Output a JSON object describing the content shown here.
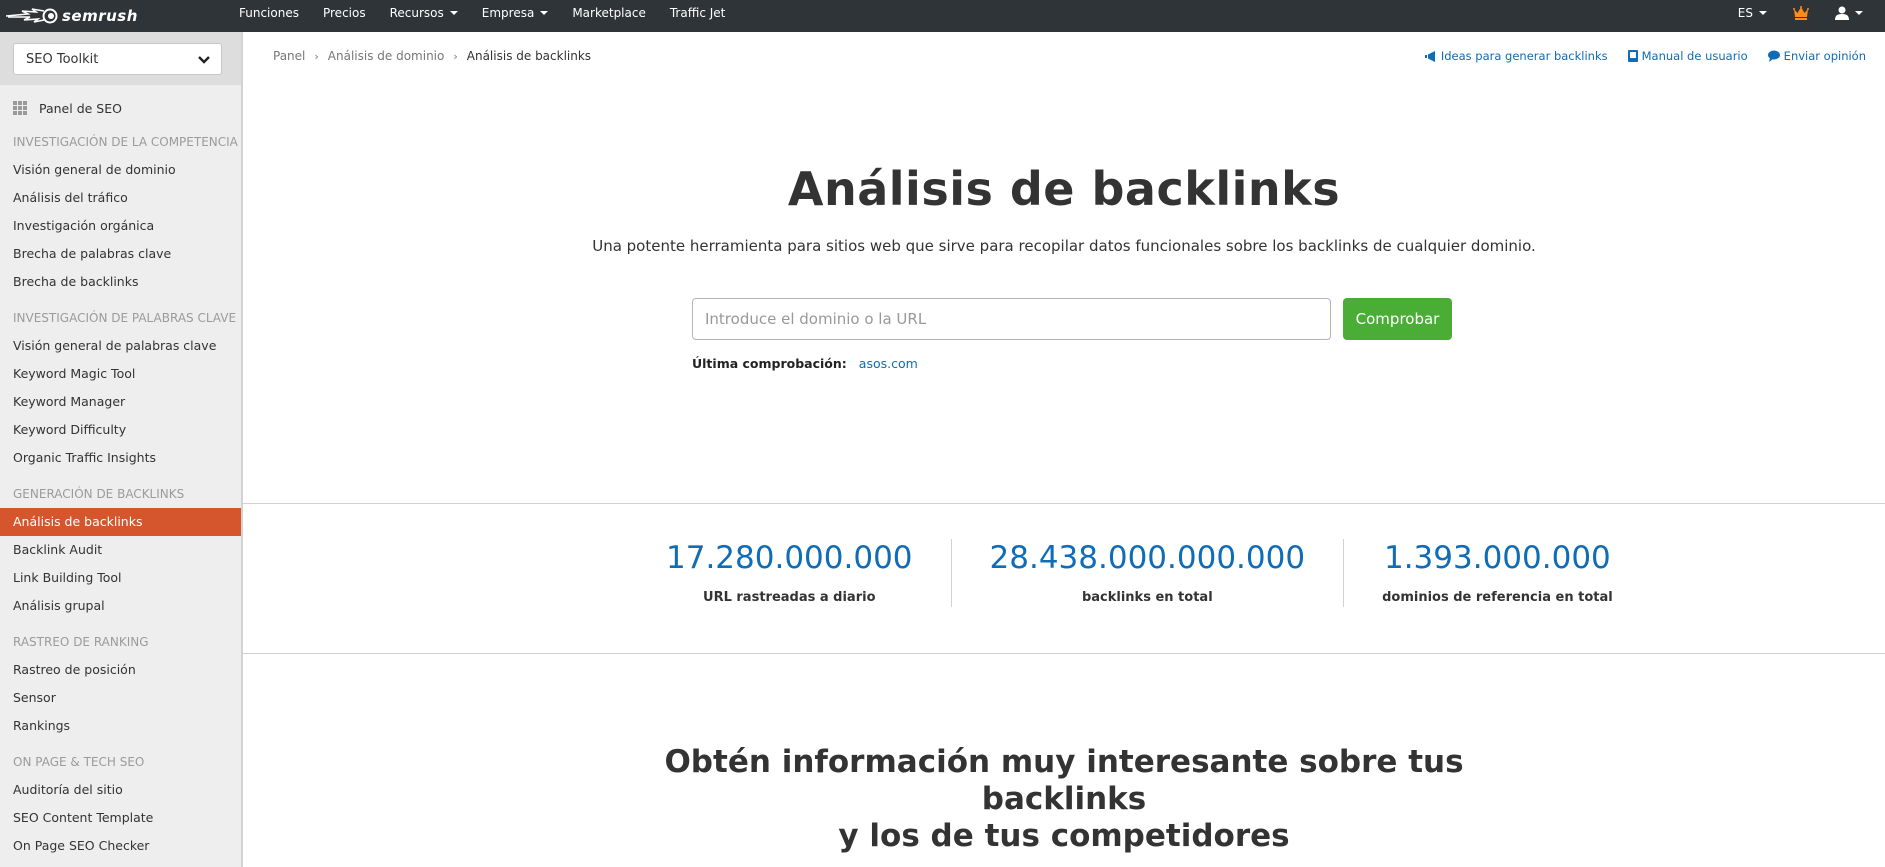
{
  "topbar": {
    "brand": "semrush",
    "nav": [
      {
        "label": "Funciones",
        "has_dropdown": false
      },
      {
        "label": "Precios",
        "has_dropdown": false
      },
      {
        "label": "Recursos",
        "has_dropdown": true
      },
      {
        "label": "Empresa",
        "has_dropdown": true
      },
      {
        "label": "Marketplace",
        "has_dropdown": false
      },
      {
        "label": "Traffic Jet",
        "has_dropdown": false
      }
    ],
    "language": "ES",
    "crown_color": "#ff8c1a",
    "icons": {
      "logo": "semrush-comet-logo",
      "crown": "crown-icon",
      "user": "user-icon"
    }
  },
  "sidebar": {
    "toolkit_selected": "SEO Toolkit",
    "dashboard_label": "Panel de SEO",
    "active_color": "#d5552d",
    "sections": [
      {
        "heading": "Investigación de la competencia",
        "items": [
          "Visión general de dominio",
          "Análisis del tráfico",
          "Investigación orgánica",
          "Brecha de palabras clave",
          "Brecha de backlinks"
        ]
      },
      {
        "heading": "Investigación de palabras clave",
        "items": [
          "Visión general de palabras clave",
          "Keyword Magic Tool",
          "Keyword Manager",
          "Keyword Difficulty",
          "Organic Traffic Insights"
        ]
      },
      {
        "heading": "Generación de backlinks",
        "items": [
          "Análisis de backlinks",
          "Backlink Audit",
          "Link Building Tool",
          "Análisis grupal"
        ]
      },
      {
        "heading": "Rastreo de ranking",
        "items": [
          "Rastreo de posición",
          "Sensor",
          "Rankings"
        ]
      },
      {
        "heading": "On Page & Tech SEO",
        "items": [
          "Auditoría del sitio",
          "SEO Content Template",
          "On Page SEO Checker"
        ]
      }
    ],
    "active_item": "Análisis de backlinks"
  },
  "breadcrumb": [
    "Panel",
    "Análisis de dominio",
    "Análisis de backlinks"
  ],
  "toplinks": [
    {
      "label": "Ideas para generar backlinks",
      "icon": "megaphone-icon"
    },
    {
      "label": "Manual de usuario",
      "icon": "book-icon"
    },
    {
      "label": "Enviar opinión",
      "icon": "speech-bubble-icon"
    }
  ],
  "hero": {
    "title": "Análisis de backlinks",
    "subtitle": "Una potente herramienta para sitios web que sirve para recopilar datos funcionales sobre los backlinks de cualquier dominio.",
    "input_value": "",
    "input_placeholder": "Introduce el dominio o la URL",
    "button_label": "Comprobar",
    "button_color": "#4aae36",
    "last_check_label": "Última comprobación:",
    "last_check_value": "asos.com"
  },
  "stats": [
    {
      "value": "17.280.000.000",
      "label": "URL rastreadas a diario"
    },
    {
      "value": "28.438.000.000.000",
      "label": "backlinks en total"
    },
    {
      "value": "1.393.000.000",
      "label": "dominios de referencia en total"
    }
  ],
  "stat_color": "#0f6cb6",
  "bottom_title": {
    "line1": "Obtén información muy interesante sobre tus",
    "line2": "backlinks",
    "line3": "y los de tus competidores"
  }
}
